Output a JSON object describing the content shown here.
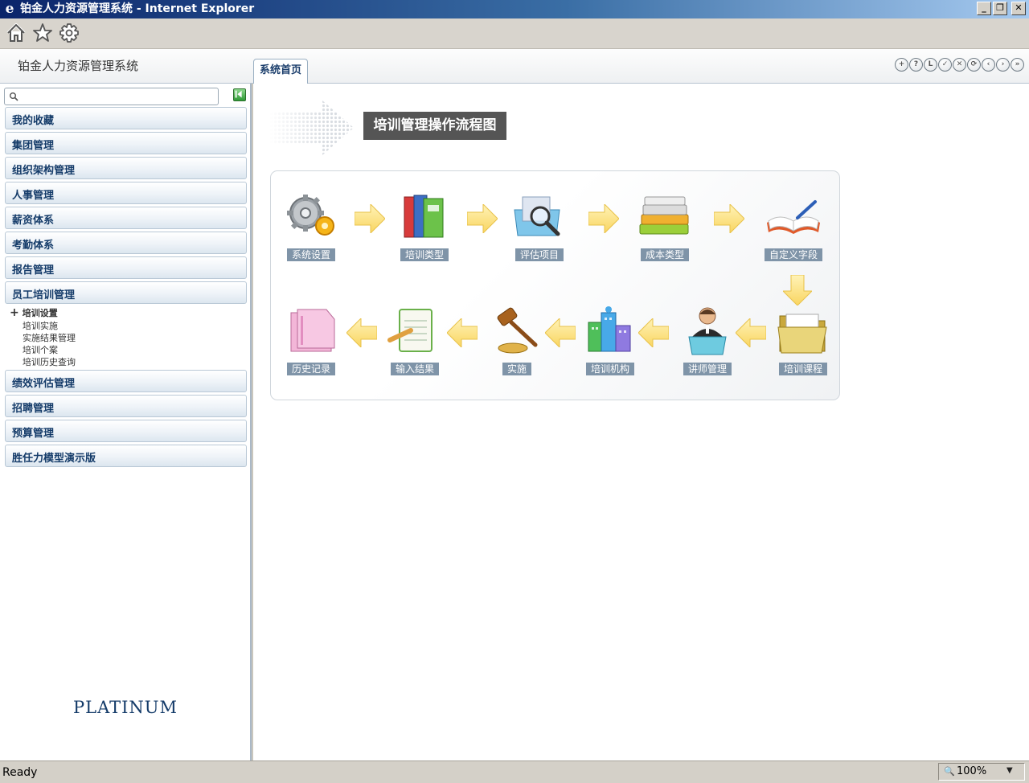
{
  "browser": {
    "window_title": "铂金人力资源管理系统 - Internet Explorer",
    "window_controls": [
      "_",
      "❐",
      "✕"
    ],
    "status": "Ready",
    "zoom": "100%"
  },
  "app": {
    "title": "铂金人力资源管理系统",
    "active_tab": "系统首页",
    "logo_text": "PLATINUM",
    "header_icon_glyphs": [
      "+",
      "?",
      "L",
      "✓",
      "✕",
      "⟳",
      "‹",
      "›",
      "»"
    ]
  },
  "sidebar": {
    "search": {
      "placeholder": "",
      "value": ""
    },
    "menu_top": [
      "我的收藏",
      "集团管理",
      "组织架构管理",
      "人事管理",
      "薪资体系",
      "考勤体系",
      "报告管理",
      "员工培训管理"
    ],
    "submenu": {
      "title": "培训设置",
      "items": [
        "培训实施",
        "实施结果管理",
        "培训个案",
        "培训历史查询"
      ]
    },
    "menu_bottom": [
      "绩效评估管理",
      "招聘管理",
      "预算管理",
      "胜任力模型演示版"
    ]
  },
  "flowchart": {
    "title": "培训管理操作流程图",
    "nodes": [
      {
        "label": "系统设置",
        "icon": "gears-icon"
      },
      {
        "label": "培训类型",
        "icon": "binders-icon"
      },
      {
        "label": "评估项目",
        "icon": "magnifier-folder-icon"
      },
      {
        "label": "成本类型",
        "icon": "books-stack-icon"
      },
      {
        "label": "自定义字段",
        "icon": "open-book-icon"
      },
      {
        "label": "培训课程",
        "icon": "folder-icon"
      },
      {
        "label": "讲师管理",
        "icon": "lecturer-icon"
      },
      {
        "label": "培训机构",
        "icon": "buildings-icon"
      },
      {
        "label": "实施",
        "icon": "gavel-icon"
      },
      {
        "label": "输入结果",
        "icon": "notepad-icon"
      },
      {
        "label": "历史记录",
        "icon": "pink-folder-icon"
      }
    ]
  },
  "colors": {
    "menu_text": "#143b69",
    "label_bg": "#7f94a8",
    "arrow_fill": "#ffe27a",
    "title_bar": "#0a246a"
  }
}
